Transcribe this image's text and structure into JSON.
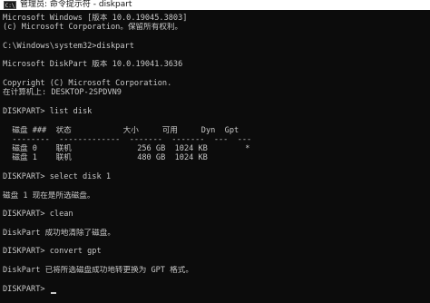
{
  "titlebar": {
    "icon_text": "C:\\",
    "title": "管理员: 命令提示符 - diskpart"
  },
  "console": {
    "lines": [
      "Microsoft Windows [版本 10.0.19045.3803]",
      "(c) Microsoft Corporation。保留所有权利。",
      "",
      "C:\\Windows\\system32>diskpart",
      "",
      "Microsoft DiskPart 版本 10.0.19041.3636",
      "",
      "Copyright (C) Microsoft Corporation.",
      "在计算机上: DESKTOP-2SPDVN9",
      "",
      "DISKPART> list disk",
      "",
      "  磁盘 ###  状态           大小     可用     Dyn  Gpt",
      "  --------  -------------  -------  -------  ---  ---",
      "  磁盘 0    联机              256 GB  1024 KB        *",
      "  磁盘 1    联机              480 GB  1024 KB",
      "",
      "DISKPART> select disk 1",
      "",
      "磁盘 1 现在是所选磁盘。",
      "",
      "DISKPART> clean",
      "",
      "DiskPart 成功地清除了磁盘。",
      "",
      "DISKPART> convert gpt",
      "",
      "DiskPart 已将所选磁盘成功地转更换为 GPT 格式。",
      "",
      "DISKPART> "
    ]
  }
}
